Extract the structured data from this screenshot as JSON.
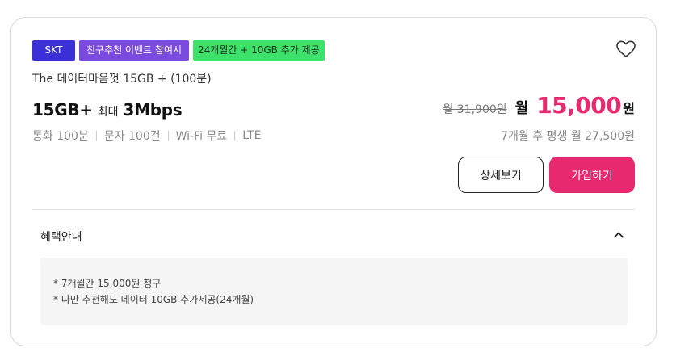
{
  "badges": {
    "carrier": "SKT",
    "event": "친구추천 이벤트 참여시",
    "bonus": "24개월간 + 10GB 추가 제공"
  },
  "plan": {
    "name": "The 데이터마음껏 15GB + (100분)",
    "data": "15GB+",
    "speed_prefix": "최대",
    "speed": "3Mbps",
    "specs": [
      "통화 100분",
      "문자 100건",
      "Wi-Fi 무료",
      "LTE"
    ]
  },
  "pricing": {
    "original": "월 31,900원",
    "month_label": "월",
    "price": "15,000",
    "currency": "원",
    "average": "7개월 후 평생 월 27,500원"
  },
  "buttons": {
    "detail": "상세보기",
    "join": "가입하기"
  },
  "benefit": {
    "title": "혜택안내",
    "lines": [
      "* 7개월간 15,000원 청구",
      "* 나만 추천해도 데이터 10GB 추가제공(24개월)"
    ]
  },
  "colors": {
    "accent": "#e8286f",
    "carrier_badge": "#3b2fd6",
    "event_badge": "#7b4be0",
    "bonus_badge": "#3de26a"
  },
  "icons": {
    "favorite": "heart-outline-icon",
    "toggle": "chevron-up-icon"
  }
}
